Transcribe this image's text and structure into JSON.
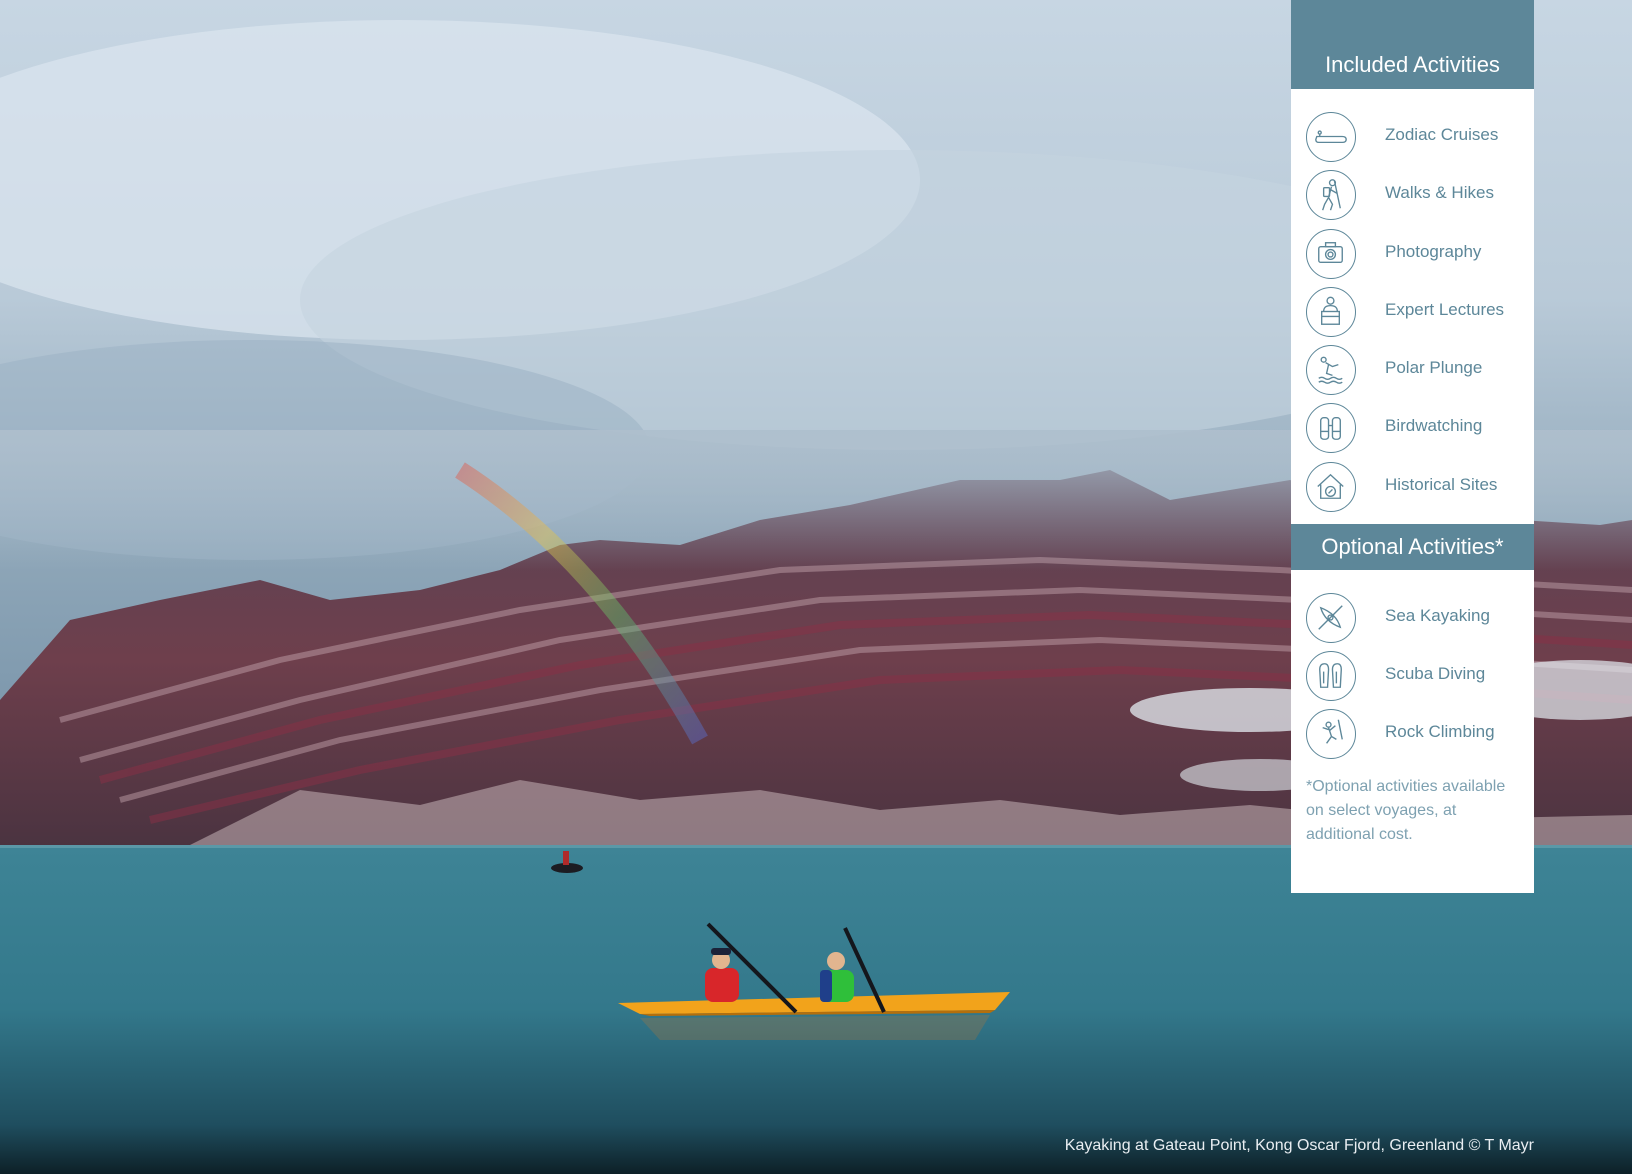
{
  "included": {
    "title": "Included Activities",
    "items": [
      {
        "label": "Zodiac Cruises",
        "icon": "zodiac-icon"
      },
      {
        "label": "Walks & Hikes",
        "icon": "hiker-icon"
      },
      {
        "label": "Photography",
        "icon": "camera-icon"
      },
      {
        "label": "Expert Lectures",
        "icon": "lecturer-icon"
      },
      {
        "label": "Polar Plunge",
        "icon": "plunge-icon"
      },
      {
        "label": "Birdwatching",
        "icon": "binoculars-icon"
      },
      {
        "label": "Historical Sites",
        "icon": "historic-house-icon"
      }
    ]
  },
  "optional": {
    "title": "Optional Activities*",
    "items": [
      {
        "label": "Sea Kayaking",
        "icon": "kayak-icon"
      },
      {
        "label": "Scuba Diving",
        "icon": "fins-icon"
      },
      {
        "label": "Rock Climbing",
        "icon": "climber-icon"
      }
    ],
    "footnote": "*Optional activities available on select voyages, at additional cost."
  },
  "caption": "Kayaking at Gateau Point, Kong Oscar Fjord, Greenland © T Mayr",
  "colors": {
    "accent": "#5d8799",
    "panel_bg": "#ffffff",
    "footnote": "#7ea1b1",
    "kayak": "#f2a31b"
  }
}
